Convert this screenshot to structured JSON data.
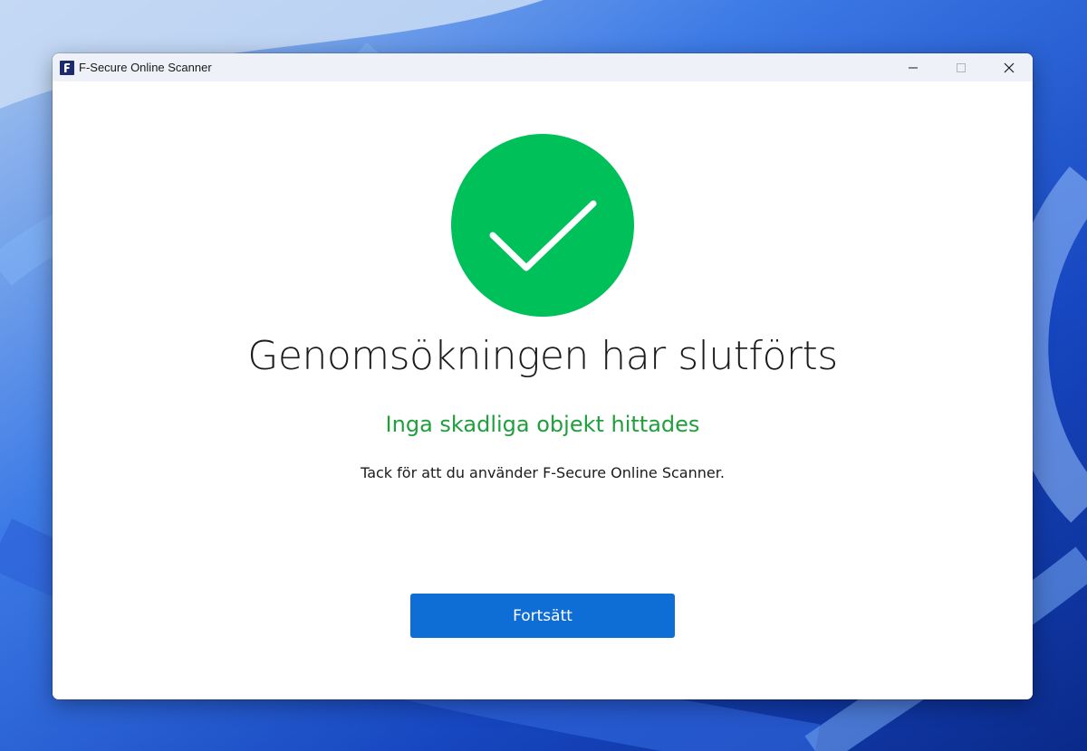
{
  "window": {
    "title": "F-Secure Online Scanner",
    "app_icon": "f-secure-logo-icon",
    "caption_buttons": [
      "minimize-icon",
      "maximize-icon",
      "close-icon"
    ]
  },
  "result": {
    "status_icon": "checkmark-icon",
    "status_color": "#00c05a",
    "headline": "Genomsökningen har slutförts",
    "subheadline": "Inga skadliga objekt hittades",
    "subheadline_color": "#1fa03c",
    "message": "Tack för att du använder F-Secure Online Scanner."
  },
  "actions": {
    "continue_label": "Fortsätt",
    "button_color": "#0f6dd6"
  }
}
